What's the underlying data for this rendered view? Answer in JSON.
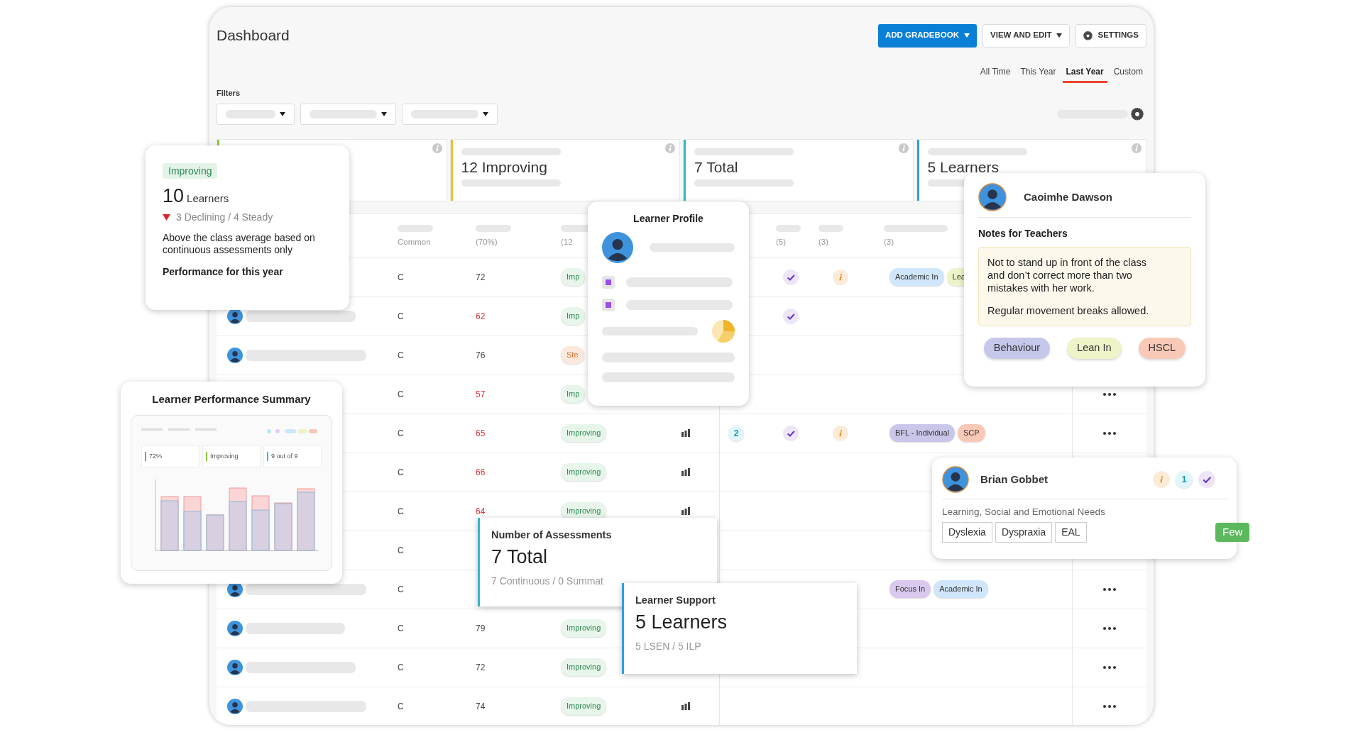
{
  "header": {
    "title": "Dashboard",
    "buttons": [
      {
        "label": "ADD GRADEBOOK",
        "kind": "primary"
      },
      {
        "label": "VIEW AND EDIT",
        "kind": "menu"
      },
      {
        "label": "SETTINGS",
        "kind": "settings"
      }
    ]
  },
  "time_tabs": [
    {
      "label": "All Time",
      "selected": false
    },
    {
      "label": "This Year",
      "selected": false
    },
    {
      "label": "Last Year",
      "selected": true
    },
    {
      "label": "Custom",
      "selected": false
    }
  ],
  "filters": {
    "label": "Filters"
  },
  "stat_cards": [
    {
      "color": "#8cc63f"
    },
    {
      "value": "12",
      "label": "Improving",
      "color": "#f2c12e"
    },
    {
      "value": "7",
      "label": "Total",
      "color": "#35b8c4"
    },
    {
      "value": "5",
      "label": "Learners",
      "color": "#2f9fe0"
    }
  ],
  "table": {
    "column_headers": {
      "grade": "Common",
      "score": "(70%)",
      "status": "(12",
      "check": "(5)",
      "info": "(3)",
      "tags": "(3)"
    },
    "rows": [
      {
        "grade": "C",
        "score": "72",
        "low": false,
        "status": {
          "label": "Imp",
          "kind": "improving"
        },
        "check": true,
        "info": true,
        "tags": [
          {
            "label": "Academic In",
            "color": "#cfe6fb"
          },
          {
            "label": "Lea",
            "color": "#eef3c8"
          }
        ]
      },
      {
        "avatar": true,
        "grade": "C",
        "score": "62",
        "low": true,
        "status": {
          "label": "Imp",
          "kind": "improving"
        },
        "check": true
      },
      {
        "avatar": true,
        "grade": "C",
        "score": "76",
        "low": false,
        "status": {
          "label": "Ste",
          "kind": "steady"
        }
      },
      {
        "grade": "C",
        "score": "57",
        "low": true,
        "status": {
          "label": "Imp",
          "kind": "improving"
        },
        "more": true
      },
      {
        "grade": "C",
        "score": "65",
        "low": true,
        "status": {
          "label": "Improving",
          "kind": "improving"
        },
        "chart": true,
        "badge": "2",
        "check": true,
        "info": true,
        "tags": [
          {
            "label": "BFL - Individual",
            "color": "#c9c6ea"
          },
          {
            "label": "SCP",
            "color": "#f9c8b6"
          }
        ],
        "more": true
      },
      {
        "grade": "C",
        "score": "66",
        "low": true,
        "status": {
          "label": "Improving",
          "kind": "improving"
        },
        "chart": true
      },
      {
        "grade": "C",
        "score": "64",
        "low": true,
        "status": {
          "label": "Improving",
          "kind": "improving"
        },
        "chart": true
      },
      {
        "grade": "C"
      },
      {
        "avatar": true,
        "grade": "C",
        "tags": [
          {
            "label": "Focus In",
            "color": "#d9c9ee"
          },
          {
            "label": "Academic In",
            "color": "#cfe6fb"
          }
        ],
        "more": true
      },
      {
        "avatar": true,
        "grade": "C",
        "score": "79",
        "low": false,
        "status": {
          "label": "Improving",
          "kind": "improving"
        },
        "more": true
      },
      {
        "avatar": true,
        "grade": "C",
        "score": "72",
        "low": false,
        "status": {
          "label": "Improving",
          "kind": "improving"
        },
        "more": true
      },
      {
        "avatar": true,
        "grade": "C",
        "score": "74",
        "low": false,
        "status": {
          "label": "Improving",
          "kind": "improving"
        },
        "chart": true,
        "more": true
      }
    ]
  },
  "improving_card": {
    "badge": "Improving",
    "count": "10",
    "unit": "Learners",
    "trend": "3 Declining / 4 Steady",
    "description": "Above the class average based on continuous assessments only",
    "footer": "Performance for this year"
  },
  "summary_card": {
    "title": "Learner Performance Summary",
    "stats": [
      {
        "value": "72%",
        "color": "#e57373"
      },
      {
        "value": "Improving",
        "color": "#8cc63f"
      },
      {
        "value": "9 out of 9",
        "color": "#4fb3e8"
      }
    ]
  },
  "profile_card": {
    "title": "Learner Profile"
  },
  "notes_card": {
    "name": "Caoimhe Dawson",
    "notes_title": "Notes for Teachers",
    "notes": [
      "Not to stand up in front of the class and don’t correct more than two mistakes with her work.",
      "Regular movement breaks allowed."
    ],
    "tags": [
      {
        "label": "Behaviour",
        "color": "#c5c8ea"
      },
      {
        "label": "Lean In",
        "color": "#eef3c8"
      },
      {
        "label": "HSCL",
        "color": "#f9c9b8"
      }
    ]
  },
  "needs_card": {
    "name": "Brian Gobbet",
    "badges": [
      {
        "kind": "info"
      },
      {
        "kind": "count",
        "label": "1"
      },
      {
        "kind": "check"
      }
    ],
    "needs_title": "Learning, Social and Emotional Needs",
    "needs": [
      "Dyslexia",
      "Dyspraxia",
      "EAL"
    ],
    "level": "Few"
  },
  "assessments_card": {
    "title": "Number of Assessments",
    "value": "7",
    "unit": "Total",
    "detail": "7 Continuous / 0 Summat"
  },
  "support_card": {
    "title": "Learner Support",
    "value": "5",
    "unit": "Learners",
    "detail": "5 LSEN / 5 ILP"
  }
}
